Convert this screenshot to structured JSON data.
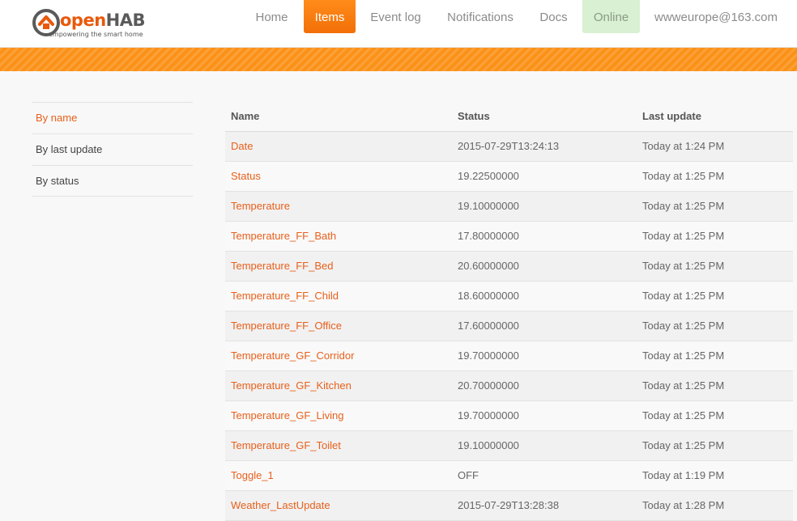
{
  "header": {
    "logo": {
      "word_open": "open",
      "word_hab": "HAB",
      "tagline": "empowering the smart home"
    },
    "nav": [
      {
        "label": "Home",
        "state": "normal"
      },
      {
        "label": "Items",
        "state": "active"
      },
      {
        "label": "Event log",
        "state": "normal"
      },
      {
        "label": "Notifications",
        "state": "normal"
      },
      {
        "label": "Docs",
        "state": "normal"
      },
      {
        "label": "Online",
        "state": "status"
      },
      {
        "label": "wwweurope@163.com",
        "state": "normal"
      }
    ]
  },
  "colors": {
    "accent": "#f26f07",
    "link": "#e8601c",
    "online_bg": "#d9f0d2"
  },
  "sidebar": {
    "items": [
      {
        "label": "By name",
        "active": true
      },
      {
        "label": "By last update",
        "active": false
      },
      {
        "label": "By status",
        "active": false
      }
    ]
  },
  "table": {
    "columns": [
      "Name",
      "Status",
      "Last update"
    ],
    "rows": [
      {
        "name": "Date",
        "status": "2015-07-29T13:24:13",
        "updated": "Today at 1:24 PM"
      },
      {
        "name": "Status",
        "status": "19.22500000",
        "updated": "Today at 1:25 PM"
      },
      {
        "name": "Temperature",
        "status": "19.10000000",
        "updated": "Today at 1:25 PM"
      },
      {
        "name": "Temperature_FF_Bath",
        "status": "17.80000000",
        "updated": "Today at 1:25 PM"
      },
      {
        "name": "Temperature_FF_Bed",
        "status": "20.60000000",
        "updated": "Today at 1:25 PM"
      },
      {
        "name": "Temperature_FF_Child",
        "status": "18.60000000",
        "updated": "Today at 1:25 PM"
      },
      {
        "name": "Temperature_FF_Office",
        "status": "17.60000000",
        "updated": "Today at 1:25 PM"
      },
      {
        "name": "Temperature_GF_Corridor",
        "status": "19.70000000",
        "updated": "Today at 1:25 PM"
      },
      {
        "name": "Temperature_GF_Kitchen",
        "status": "20.70000000",
        "updated": "Today at 1:25 PM"
      },
      {
        "name": "Temperature_GF_Living",
        "status": "19.70000000",
        "updated": "Today at 1:25 PM"
      },
      {
        "name": "Temperature_GF_Toilet",
        "status": "19.10000000",
        "updated": "Today at 1:25 PM"
      },
      {
        "name": "Toggle_1",
        "status": "OFF",
        "updated": "Today at 1:19 PM"
      },
      {
        "name": "Weather_LastUpdate",
        "status": "2015-07-29T13:28:38",
        "updated": "Today at 1:28 PM"
      }
    ]
  }
}
